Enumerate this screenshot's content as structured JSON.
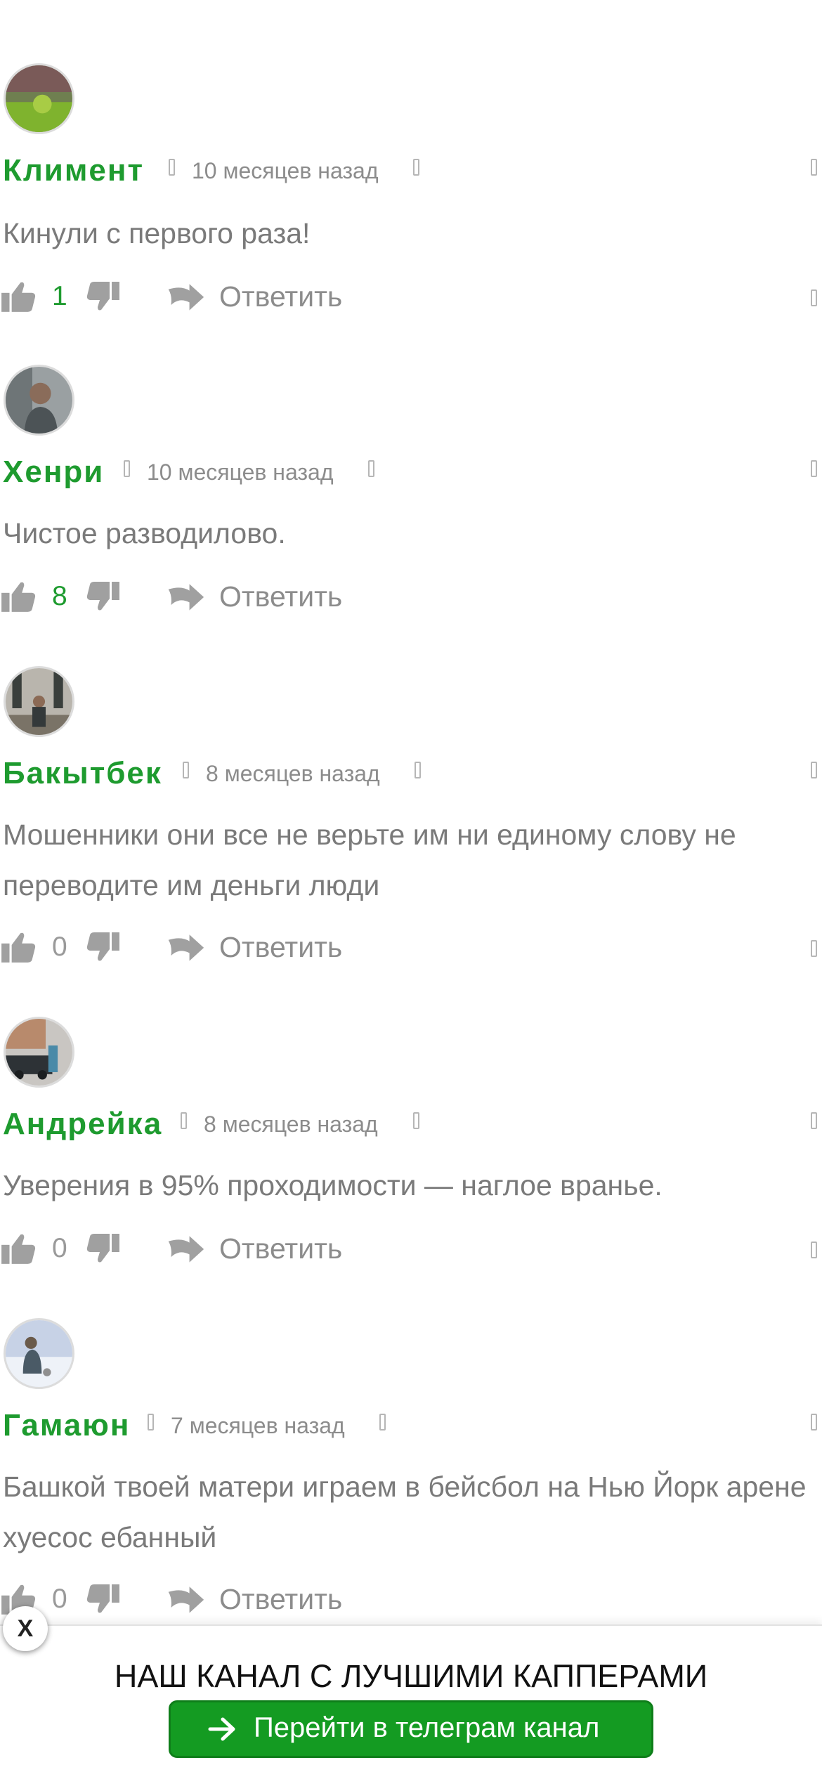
{
  "comments": [
    {
      "author": "Климент",
      "time": "10 месяцев назад",
      "text": "Кинули с первого раза!",
      "likes": "1",
      "reply": "Ответить"
    },
    {
      "author": "Хенри",
      "time": "10 месяцев назад",
      "text": "Чистое разводилово.",
      "likes": "8",
      "reply": "Ответить"
    },
    {
      "author": "Бакытбек",
      "time": "8 месяцев назад",
      "text": "Мошенники они все не верьте им ни единому слову не переводите им деньги люди",
      "likes": "0",
      "reply": "Ответить"
    },
    {
      "author": "Андрейка",
      "time": "8 месяцев назад",
      "text": "Уверения в 95% проходимости — наглое вранье.",
      "likes": "0",
      "reply": "Ответить"
    },
    {
      "author": "Гамаюн",
      "time": "7 месяцев назад",
      "text": "Башкой твоей матери играем в бейсбол на Нью Йорк арене хуесос ебанный",
      "likes": "0",
      "reply": "Ответить"
    }
  ],
  "banner": {
    "close": "X",
    "title": "НАШ КАНАЛ С ЛУЧШИМИ КАППЕРАМИ",
    "button": "Перейти в телеграм канал"
  },
  "colors": {
    "author": "#1e9b2f",
    "like_positive": "#1e9b2f",
    "like_zero": "#9a9a9a",
    "icon": "#a0a0a0",
    "button": "#149b22"
  },
  "icons": {
    "like": "thumbs-up-icon",
    "dislike": "thumbs-down-icon",
    "reply": "reply-arrow-icon",
    "telegram_arrow": "arrow-right-icon"
  }
}
